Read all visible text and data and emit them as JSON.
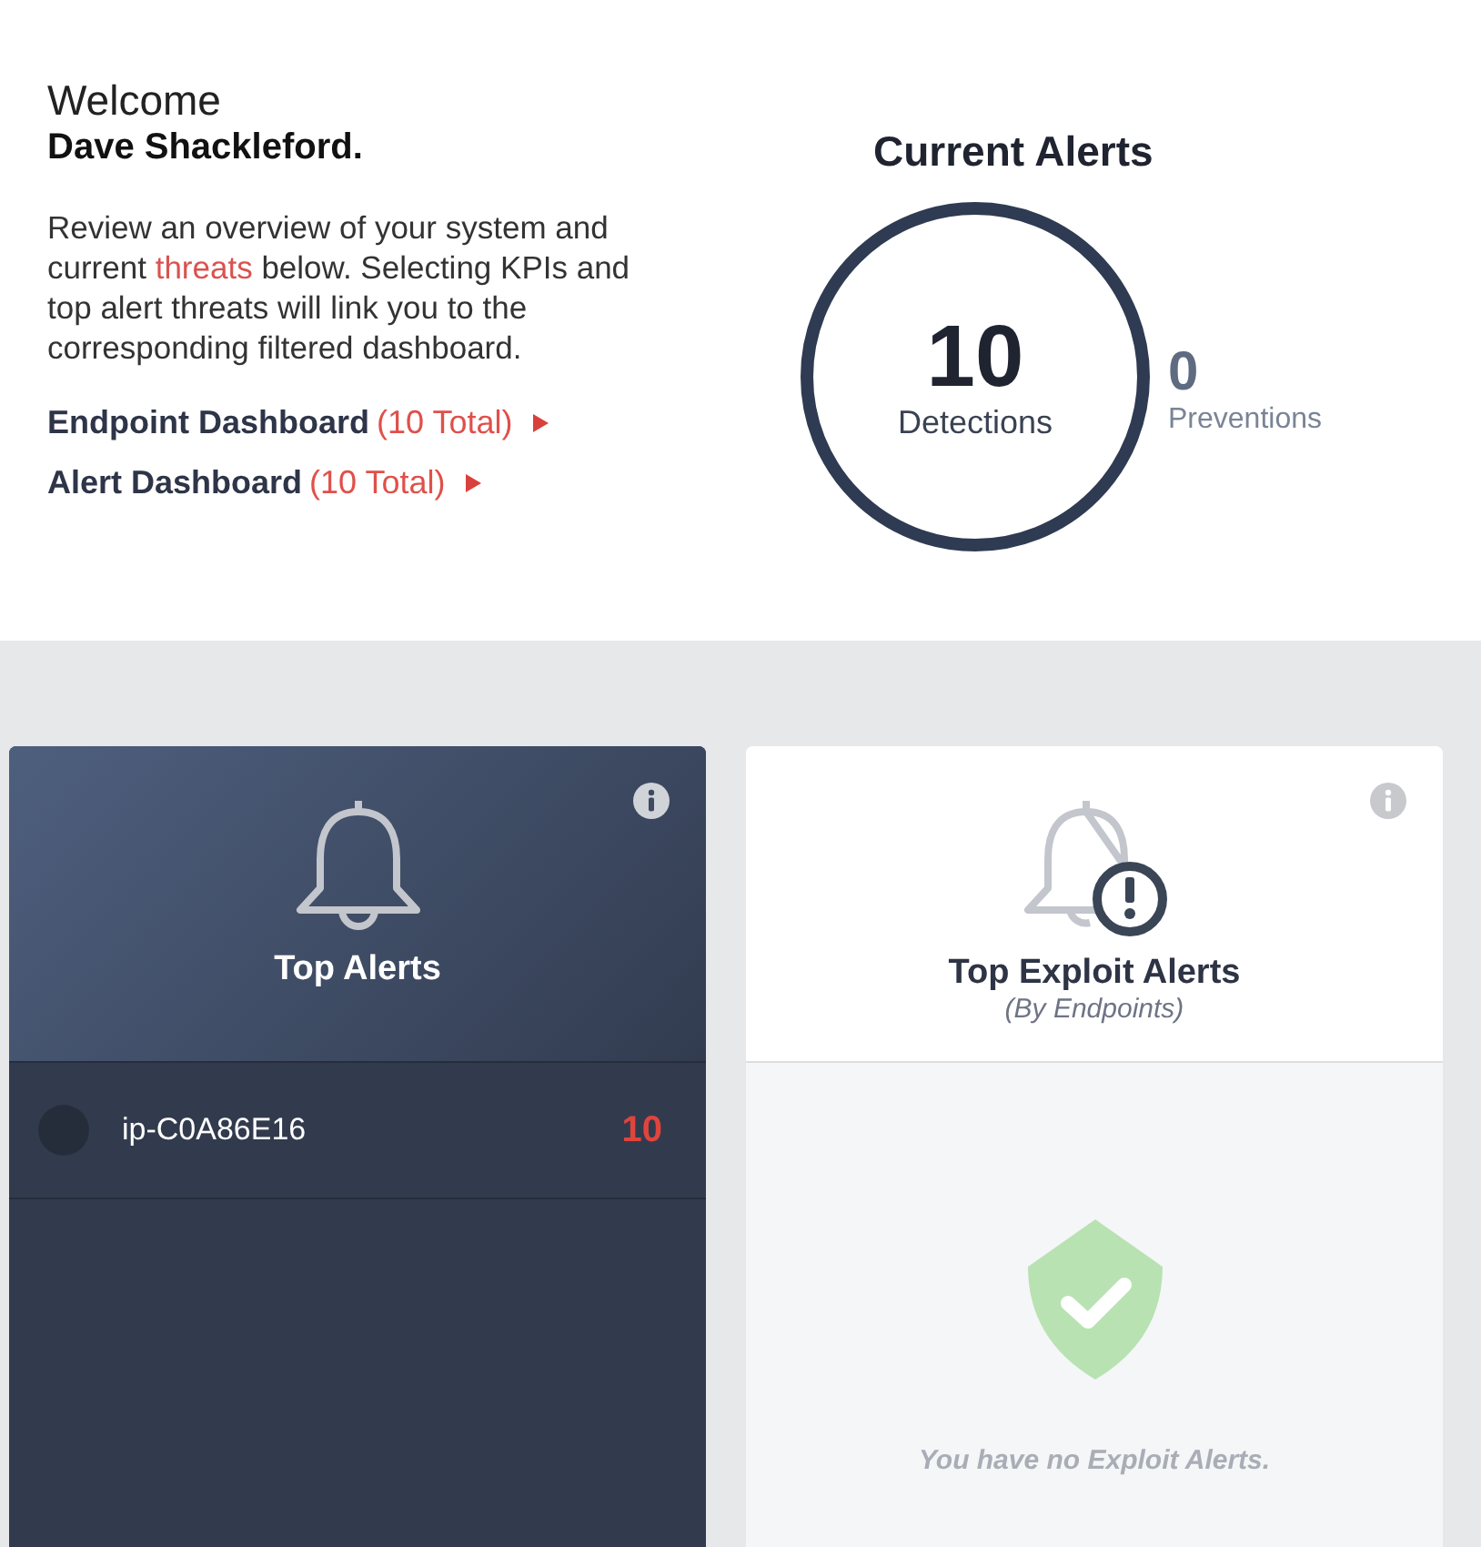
{
  "welcome": {
    "greeting": "Welcome",
    "name": "Dave Shackleford.",
    "intro_before": "Review an overview of your system and current",
    "intro_link": "threats",
    "intro_after": "below. Selecting KPIs and top alert threats will link you to the corresponding filtered dashboard.",
    "links": [
      {
        "label": "Endpoint Dashboard",
        "count": "(10 Total)"
      },
      {
        "label": "Alert Dashboard",
        "count": "(10 Total)"
      }
    ]
  },
  "current_alerts": {
    "title": "Current Alerts",
    "detections": {
      "value": "10",
      "label": "Detections"
    },
    "preventions": {
      "value": "0",
      "label": "Preventions"
    }
  },
  "cards": [
    {
      "kind": "list",
      "title": "Top Alerts",
      "rows": [
        {
          "host": "ip-C0A86E16",
          "count": "10"
        }
      ]
    },
    {
      "kind": "empty",
      "title": "Top Exploit Alerts",
      "subtitle": "(By Endpoints)",
      "message": "You have no Exploit Alerts."
    }
  ]
}
